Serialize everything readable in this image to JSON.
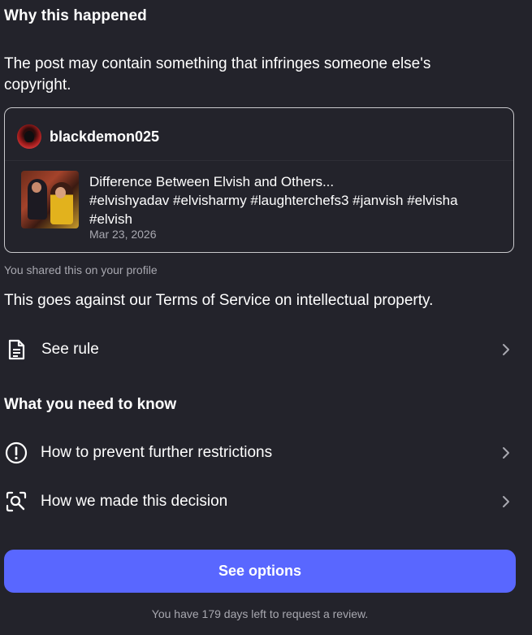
{
  "why": {
    "title": "Why this happened",
    "reason": "The post may contain something that infringes someone else's copyright."
  },
  "post": {
    "username": "blackdemon025",
    "text_line1": "Difference Between Elvish and Others...",
    "text_line2": "#elvishyadav #elvisharmy #laughterchefs3 #janvish #elvisha",
    "text_line3": "#elvish",
    "date": "Mar 23, 2026"
  },
  "shared_note": "You shared this on your profile",
  "tos_text": "This goes against our Terms of Service on intellectual property.",
  "rule_row": {
    "label": "See rule",
    "icon": "document-icon"
  },
  "know": {
    "title": "What you need to know",
    "items": [
      {
        "label": "How to prevent further restrictions",
        "icon": "exclamation-circle-icon"
      },
      {
        "label": "How we made this decision",
        "icon": "magnify-scan-icon"
      }
    ]
  },
  "cta": {
    "label": "See options",
    "color": "#5967ff"
  },
  "footer_note": "You have 179 days left to request a review."
}
